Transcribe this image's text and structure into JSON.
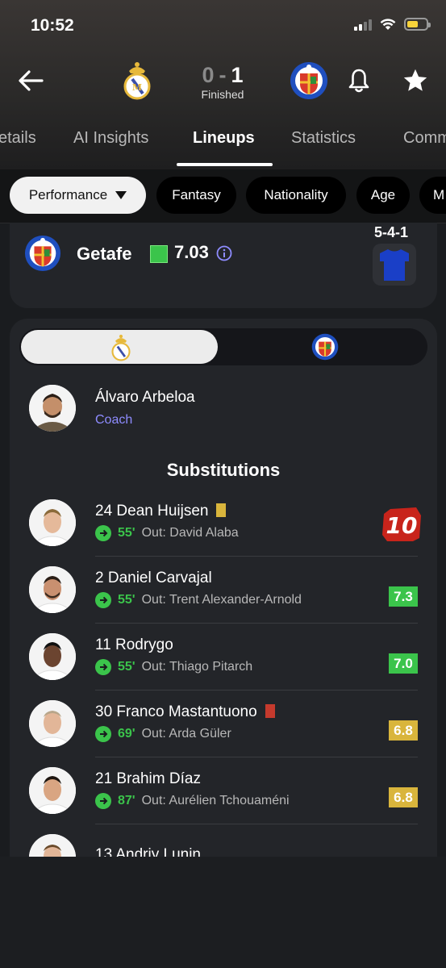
{
  "status_bar": {
    "time": "10:52"
  },
  "match": {
    "home_score": "0",
    "separator": "-",
    "away_score": "1",
    "status": "Finished"
  },
  "tabs": [
    {
      "label": "etails"
    },
    {
      "label": "AI Insights"
    },
    {
      "label": "Lineups",
      "active": true
    },
    {
      "label": "Statistics"
    },
    {
      "label": "Comm"
    }
  ],
  "filters": [
    {
      "label": "Performance",
      "active": true
    },
    {
      "label": "Fantasy"
    },
    {
      "label": "Nationality"
    },
    {
      "label": "Age"
    },
    {
      "label": "M"
    }
  ],
  "team_summary": {
    "name": "Getafe",
    "rating": "7.03",
    "formation": "5-4-1",
    "jersey_color": "#1a3fc7"
  },
  "coach": {
    "name": "Álvaro Arbeloa",
    "role": "Coach"
  },
  "substitutions_title": "Substitutions",
  "substitutions": [
    {
      "name": "24 Dean Huijsen",
      "card": "yellow",
      "minute": "55'",
      "out": "Out: David Alaba",
      "rating": "10",
      "rating_style": "top"
    },
    {
      "name": "2 Daniel Carvajal",
      "card": "",
      "minute": "55'",
      "out": "Out: Trent Alexander-Arnold",
      "rating": "7.3",
      "rating_style": "green"
    },
    {
      "name": "11 Rodrygo",
      "card": "",
      "minute": "55'",
      "out": "Out: Thiago Pitarch",
      "rating": "7.0",
      "rating_style": "green"
    },
    {
      "name": "30 Franco Mastantuono",
      "card": "red",
      "minute": "69'",
      "out": "Out: Arda Güler",
      "rating": "6.8",
      "rating_style": "yellow"
    },
    {
      "name": "21 Brahim Díaz",
      "card": "",
      "minute": "87'",
      "out": "Out: Aurélien Tchouaméni",
      "rating": "6.8",
      "rating_style": "yellow"
    },
    {
      "name": "13 Andriy Lunin",
      "card": "",
      "minute": "",
      "out": "",
      "rating": "",
      "rating_style": ""
    }
  ],
  "colors": {
    "accent_green": "#3bc44b",
    "rating_yellow": "#d9b53c",
    "red_card": "#c53a2d",
    "coach_role": "#8e8cff"
  }
}
